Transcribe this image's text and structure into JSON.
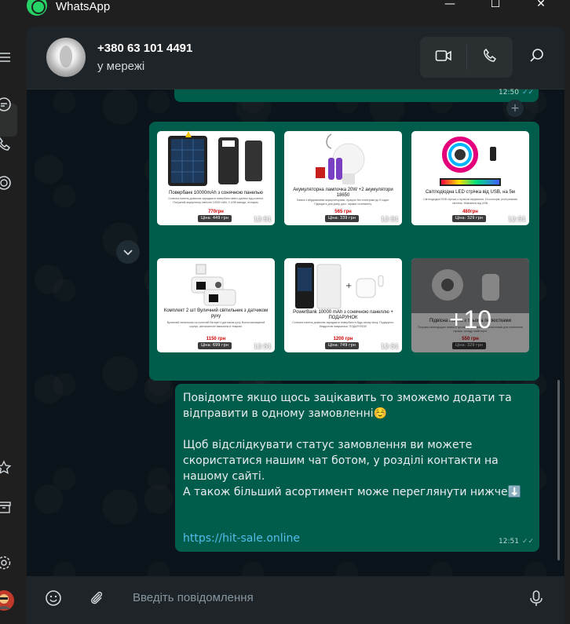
{
  "app": {
    "title": "WhatsApp",
    "minimize": "—",
    "maximize": "☐",
    "close": "✕"
  },
  "rail": {
    "icons": [
      "menu-icon",
      "chats-icon",
      "calls-icon",
      "status-icon",
      "starred-icon",
      "archive-icon",
      "settings-icon",
      "profile-avatar"
    ]
  },
  "header": {
    "contact_name": "+380 63 101 4491",
    "status": "у мережі",
    "video_call_icon": "video-camera-icon",
    "voice_call_icon": "phone-icon",
    "search_icon": "search-icon"
  },
  "previous_message": {
    "time": "12:50",
    "ticks": "✓✓"
  },
  "album": {
    "items": [
      {
        "title": "Повербанк 10000mAh з сонячною панелью",
        "desc": "Сонячна панель дозволяє заряджати повербанк навіть далеко від розетки. Потужний акумулятор ємністю 10000 mAh, 2 USB виходи, ліхтарик.",
        "price": "770грн",
        "tag": "Ціна: 449 грн",
        "time": "12:51"
      },
      {
        "title": "Акумуляторна лампочка 20W +2 акумулятори 18650",
        "desc": "Лампа з вбудованими акумуляторами, працює без електрики до 5 годин. Підходить для дому, дачі, гаража та кемпінгу.",
        "price": "565 грн",
        "tag": "Ціна: 339 грн",
        "time": "12:51"
      },
      {
        "title": "Світлодіодна LED стрічка від USB, на 5м",
        "desc": "Світлодіодна RGB стрічка з пультом керування, 16 кольорів, різні режими світіння. Живлення від USB.",
        "price": "480грн",
        "tag": "Ціна: 329 грн",
        "time": "12:51"
      },
      {
        "title": "Комплект 2 шт Вуличний світильник з датчиком руху",
        "desc": "Вуличний світильник на сонячній батареї з датчиком руху. Вологозахищений корпус, автоматичне вмикання в темряві.",
        "price": "1150 грн",
        "tag": "Ціна: 699 грн",
        "time": "12:51"
      },
      {
        "title": "PowerBank 10000 mAh з сонячною панеллю + ПОДАРУНОК",
        "desc": "Сонячна панель дозволяє заряджати повербанк в будь-якому місці. Подарунок: бездротові навушники. ПОДАРУНОК!",
        "price": "1200 грн",
        "tag": "Ціна: 749 грн",
        "time": "12:51"
      },
      {
        "title": "Підвісна лампа з трьома пелюстками",
        "desc": "Потужна світлодіодна лампа з трьома регульованими пелюстками для освітлення гаража, складу, майстерні.",
        "price": "550 грн",
        "tag": "Ціна: 329 грн",
        "time": "12:51",
        "more": "+10"
      }
    ]
  },
  "message": {
    "p1": "Повідомте якщо щось зацікавить то зможемо додати та відправити в одному замовленні☺️",
    "p2": "Щоб відслідкувати статус замовлення ви можете скористатися нашим чат ботом, у розділі контакти на нашому сайті.",
    "p3": "А також більший асортимент може переглянути  нижче⬇️",
    "link": "https://hit-sale.online",
    "time": "12:51",
    "ticks": "✓✓"
  },
  "composer": {
    "placeholder": "Введіть повідомлення",
    "emoji_icon": "emoji-icon",
    "attach_icon": "paperclip-icon",
    "mic_icon": "microphone-icon"
  },
  "colors": {
    "outgoing_bubble": "#005c4b",
    "link": "#53bdeb",
    "chat_bg": "#0b141a",
    "header_bg": "#1f2428"
  }
}
